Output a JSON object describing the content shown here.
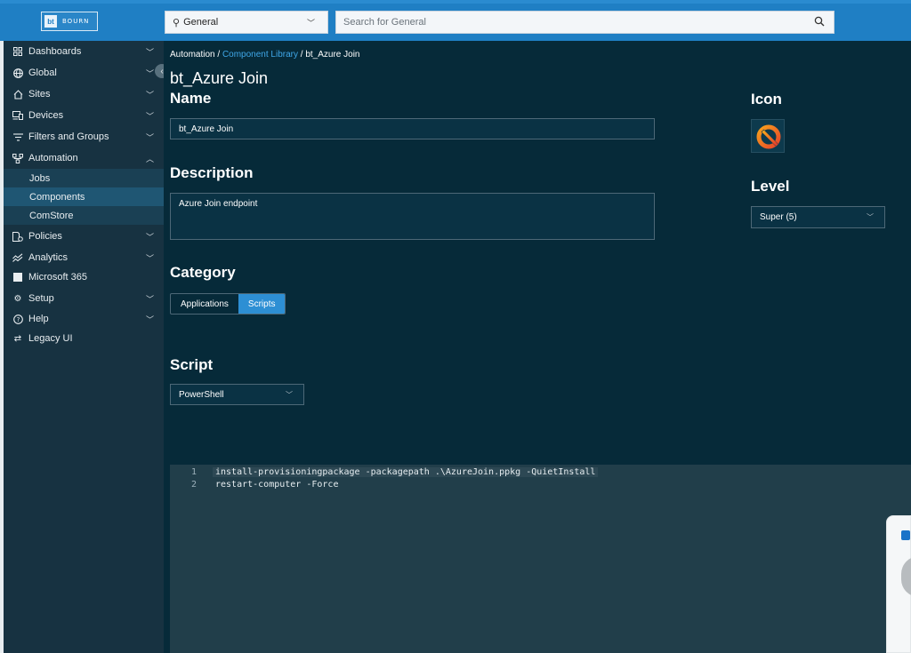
{
  "topbar": {
    "logo_mark": "bt",
    "logo_text": "BOURN",
    "scope_select": "General",
    "search_placeholder": "Search for General"
  },
  "sidebar": {
    "items": [
      {
        "label": "Dashboards",
        "icon": "dashboard-grid-icon",
        "chevron": true
      },
      {
        "label": "Global",
        "icon": "globe-icon",
        "chevron": true
      },
      {
        "label": "Sites",
        "icon": "home-icon",
        "chevron": true
      },
      {
        "label": "Devices",
        "icon": "devices-icon",
        "chevron": true
      },
      {
        "label": "Filters and Groups",
        "icon": "filter-icon",
        "chevron": true
      },
      {
        "label": "Automation",
        "icon": "automation-icon",
        "chevron": true,
        "expanded": true
      }
    ],
    "sub_items": [
      {
        "label": "Jobs",
        "active": false
      },
      {
        "label": "Components",
        "active": true
      },
      {
        "label": "ComStore",
        "active": false
      }
    ],
    "items_after": [
      {
        "label": "Policies",
        "icon": "policy-icon",
        "chevron": true
      },
      {
        "label": "Analytics",
        "icon": "analytics-icon",
        "chevron": true
      },
      {
        "label": "Microsoft 365",
        "icon": "microsoft-icon",
        "chevron": false
      },
      {
        "label": "Setup",
        "icon": "gear-icon",
        "chevron": true
      },
      {
        "label": "Help",
        "icon": "help-icon",
        "chevron": true
      },
      {
        "label": "Legacy UI",
        "icon": "switch-icon",
        "chevron": false
      }
    ]
  },
  "breadcrumb": {
    "part1": "Automation",
    "sep": " / ",
    "link": "Component Library",
    "part3": "bt_Azure Join"
  },
  "page_title": "bt_Azure Join",
  "form": {
    "name_label": "Name",
    "name_value": "bt_Azure Join",
    "description_label": "Description",
    "description_value": "Azure Join endpoint",
    "category_label": "Category",
    "category_options": [
      "Applications",
      "Scripts"
    ],
    "category_selected": "Scripts",
    "script_label": "Script",
    "script_value": "PowerShell",
    "icon_label": "Icon",
    "level_label": "Level",
    "level_value": "Super (5)"
  },
  "editor": {
    "lines": [
      {
        "num": "1",
        "code": "install-provisioningpackage -packagepath .\\AzureJoin.ppkg -QuietInstall"
      },
      {
        "num": "2",
        "code": "restart-computer -Force"
      }
    ]
  },
  "colors": {
    "topbar": "#1f7fc4",
    "sidebar": "#173241",
    "main": "#062a39",
    "accent": "#2d8fd4",
    "link": "#3fa7e8"
  }
}
